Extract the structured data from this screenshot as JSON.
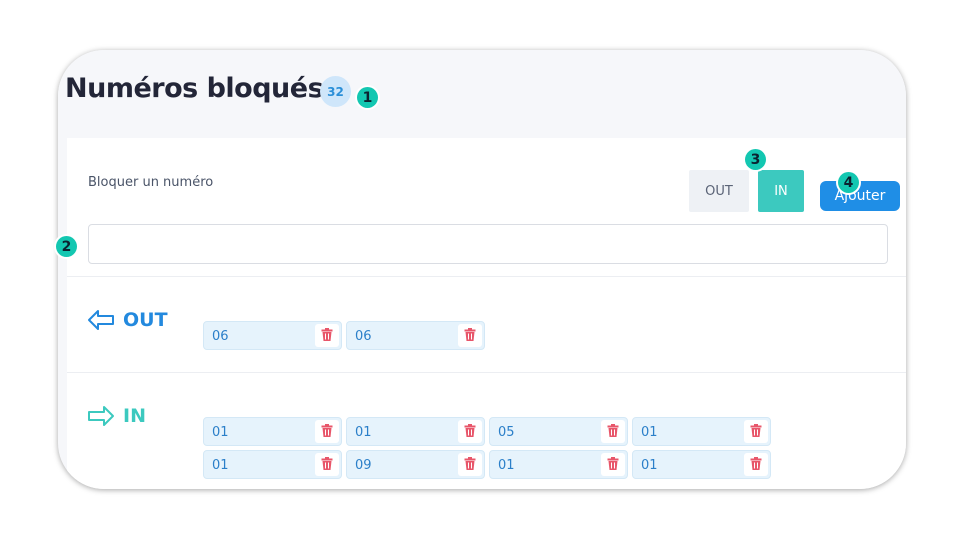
{
  "header": {
    "title": "Numéros bloqués",
    "count": "32"
  },
  "callouts": [
    "1",
    "2",
    "3",
    "4"
  ],
  "form": {
    "label": "Bloquer un numéro",
    "input_value": "",
    "input_placeholder": "",
    "direction_options": [
      "OUT",
      "IN"
    ],
    "selected_direction": "IN",
    "add_label": "Ajouter"
  },
  "sections": {
    "out": {
      "title": "OUT",
      "icon": "arrow-left-icon",
      "numbers": [
        "06",
        "06"
      ]
    },
    "in": {
      "title": "IN",
      "icon": "arrow-right-icon",
      "numbers": [
        "01",
        "01",
        "05",
        "01",
        "01",
        "09",
        "01",
        "01"
      ]
    }
  },
  "colors": {
    "out_accent": "#2389de",
    "in_accent": "#3cc9bf",
    "add_button": "#1f8ee6",
    "callout": "#13c7b1",
    "delete_icon": "#e8566a"
  }
}
